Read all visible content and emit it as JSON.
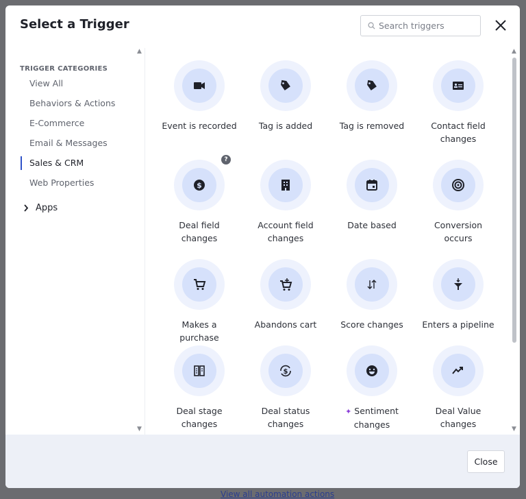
{
  "background_link": "View all automation actions",
  "header": {
    "title": "Select a Trigger",
    "search_placeholder": "Search triggers"
  },
  "sidebar": {
    "heading": "TRIGGER CATEGORIES",
    "items": [
      {
        "label": "View All"
      },
      {
        "label": "Behaviors & Actions"
      },
      {
        "label": "E-Commerce"
      },
      {
        "label": "Email & Messages"
      },
      {
        "label": "Sales & CRM",
        "active": true
      },
      {
        "label": "Web Properties"
      }
    ],
    "apps_label": "Apps"
  },
  "triggers": [
    {
      "label": "Event is recorded",
      "icon": "video-camera-icon"
    },
    {
      "label": "Tag is added",
      "icon": "tag-icon"
    },
    {
      "label": "Tag is removed",
      "icon": "tag-icon"
    },
    {
      "label": "Contact field changes",
      "icon": "contact-card-icon"
    },
    {
      "label": "Deal field changes",
      "icon": "dollar-circle-icon",
      "help_badge": "?"
    },
    {
      "label": "Account field changes",
      "icon": "building-icon"
    },
    {
      "label": "Date based",
      "icon": "calendar-icon"
    },
    {
      "label": "Conversion occurs",
      "icon": "target-icon"
    },
    {
      "label": "Makes a purchase",
      "icon": "cart-icon"
    },
    {
      "label": "Abandons cart",
      "icon": "cart-plus-icon"
    },
    {
      "label": "Score changes",
      "icon": "up-down-arrows-icon"
    },
    {
      "label": "Enters a pipeline",
      "icon": "funnel-icon"
    },
    {
      "label": "Deal stage changes",
      "icon": "columns-icon"
    },
    {
      "label": "Deal status changes",
      "icon": "dollar-cycle-icon"
    },
    {
      "label": "Sentiment changes",
      "icon": "smiley-icon",
      "ai_sparkle": true
    },
    {
      "label": "Deal Value changes",
      "icon": "trend-up-icon"
    }
  ],
  "footer": {
    "close_label": "Close"
  },
  "colors": {
    "accent": "#2f52c8",
    "icon_core": "#d6e1fb",
    "icon_halo": "#eef2fd",
    "footer_bg": "#edf0f7"
  }
}
